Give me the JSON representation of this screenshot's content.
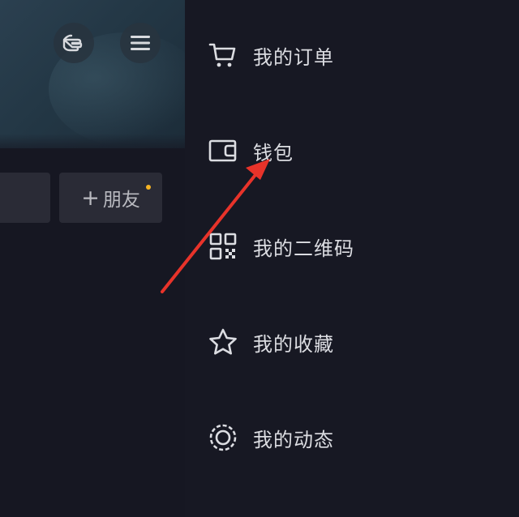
{
  "profile": {
    "add_friend_label": "朋友",
    "add_friend_plus": "+",
    "notification_dot_color": "#f5b323",
    "pointer_icon": "hand-pointer-icon",
    "menu_icon": "hamburger-menu-icon"
  },
  "drawer": {
    "items": [
      {
        "label": "我的订单",
        "icon": "cart-icon"
      },
      {
        "label": "钱包",
        "icon": "wallet-icon"
      },
      {
        "label": "我的二维码",
        "icon": "qr-code-icon"
      },
      {
        "label": "我的收藏",
        "icon": "star-icon"
      },
      {
        "label": "我的动态",
        "icon": "moments-circle-icon"
      }
    ]
  },
  "annotation": {
    "arrow_color": "#e8332a",
    "arrow_target": "钱包"
  }
}
